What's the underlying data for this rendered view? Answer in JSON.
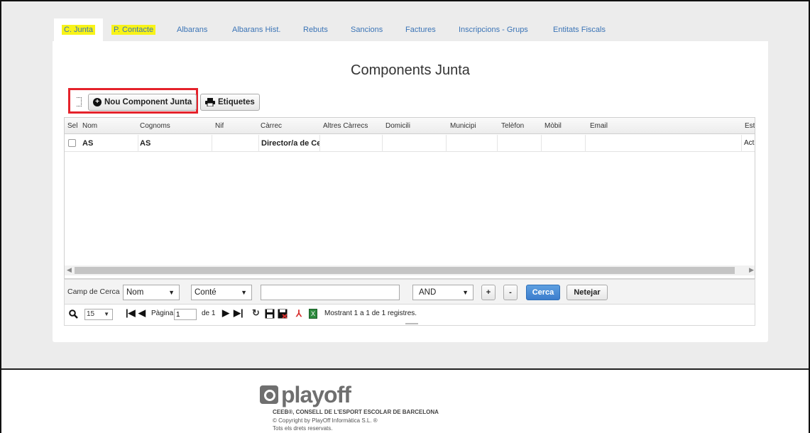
{
  "tabs": [
    {
      "label": "C. Junta"
    },
    {
      "label": "P. Contacte"
    },
    {
      "label": "Albarans"
    },
    {
      "label": "Albarans Hist."
    },
    {
      "label": "Rebuts"
    },
    {
      "label": "Sancions"
    },
    {
      "label": "Factures"
    },
    {
      "label": "Inscripcions - Grups"
    },
    {
      "label": "Entitats Fiscals"
    }
  ],
  "page_title": "Components Junta",
  "toolbar": {
    "new_label": "Nou Component Junta",
    "labels_label": "Etiquetes"
  },
  "grid": {
    "columns": [
      "Sel",
      "Nom",
      "Cognoms",
      "Nif",
      "Càrrec",
      "Altres Càrrecs",
      "Domicili",
      "Municipi",
      "Telèfon",
      "Mòbil",
      "Email",
      "Est"
    ],
    "rows": [
      {
        "nom": "AS",
        "cognoms": "AS",
        "nif": "",
        "carrec": "Director/a de Cer",
        "altres": "",
        "domicili": "",
        "municipi": "",
        "telefon": "",
        "mobil": "",
        "email": "",
        "est": "Act"
      }
    ]
  },
  "search": {
    "label": "Camp de Cerca",
    "field_value": "Nom",
    "operator_value": "Conté",
    "text_value": "",
    "logic_value": "AND",
    "plus_label": "+",
    "minus_label": "-",
    "search_label": "Cerca",
    "clear_label": "Netejar"
  },
  "pager": {
    "page_size": "15",
    "page_label": "Pàgina",
    "page_value": "1",
    "of_label": "de 1",
    "status": "Mostrant 1 a 1 de 1 registres."
  },
  "footer": {
    "logo": "playoff",
    "line1": "CEEB®, CONSELL DE L'ESPORT ESCOLAR DE BARCELONA",
    "line2": "© Copyright by PlayOff Informàtica S.L. ®",
    "line3": "Tots els drets reservats."
  },
  "colors": {
    "highlight": "#f8f318",
    "red_box": "#e5222b",
    "link": "#3b74b6",
    "primary_button": "#3c7dcd"
  }
}
